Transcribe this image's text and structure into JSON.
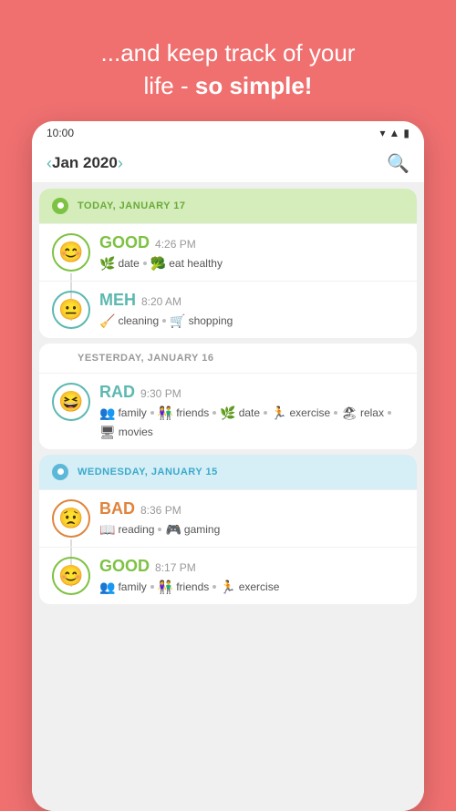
{
  "header": {
    "line1": "...and keep track of your",
    "line2_normal": "life - ",
    "line2_bold": "so simple!"
  },
  "statusBar": {
    "time": "10:00",
    "icons": [
      "wifi",
      "signal",
      "battery"
    ]
  },
  "nav": {
    "prevLabel": "‹",
    "nextLabel": "›",
    "title": "Jan 2020",
    "searchLabel": "🔍"
  },
  "days": [
    {
      "id": "today",
      "dotColor": "green",
      "label": "TODAY, JANUARY 17",
      "entries": [
        {
          "mood": "GOOD",
          "moodClass": "mood-green",
          "iconClass": "icon-green",
          "iconEmoji": "😊",
          "time": "4:26 PM",
          "tags": [
            {
              "icon": "🌿",
              "label": "date"
            },
            {
              "icon": "🥦",
              "label": "eat healthy"
            }
          ]
        },
        {
          "mood": "MEH",
          "moodClass": "mood-teal",
          "iconClass": "icon-teal",
          "iconEmoji": "😐",
          "time": "8:20 AM",
          "tags": [
            {
              "icon": "🧹",
              "label": "cleaning"
            },
            {
              "icon": "🛒",
              "label": "shopping"
            }
          ]
        }
      ]
    },
    {
      "id": "yesterday",
      "dotColor": "none",
      "label": "YESTERDAY, JANUARY 16",
      "labelClass": "day-label-gray",
      "entries": [
        {
          "mood": "RAD",
          "moodClass": "mood-teal",
          "iconClass": "icon-teal",
          "iconEmoji": "😆",
          "time": "9:30 PM",
          "tags": [
            {
              "icon": "👥",
              "label": "family"
            },
            {
              "icon": "👫",
              "label": "friends"
            },
            {
              "icon": "🌿",
              "label": "date"
            },
            {
              "icon": "🏃",
              "label": "exercise"
            },
            {
              "icon": "🏖",
              "label": "relax"
            },
            {
              "icon": "🖥",
              "label": "movies"
            }
          ]
        }
      ]
    },
    {
      "id": "wednesday",
      "dotColor": "blue",
      "label": "WEDNESDAY, JANUARY 15",
      "entries": [
        {
          "mood": "BAD",
          "moodClass": "mood-orange",
          "iconClass": "icon-orange",
          "iconEmoji": "😟",
          "time": "8:36 PM",
          "tags": [
            {
              "icon": "📖",
              "label": "reading"
            },
            {
              "icon": "🎮",
              "label": "gaming"
            }
          ]
        },
        {
          "mood": "GOOD",
          "moodClass": "mood-green",
          "iconClass": "icon-green",
          "iconEmoji": "😊",
          "time": "8:17 PM",
          "tags": [
            {
              "icon": "👥",
              "label": "family"
            },
            {
              "icon": "👫",
              "label": "friends"
            },
            {
              "icon": "🏃",
              "label": "exercise"
            }
          ]
        }
      ]
    }
  ]
}
